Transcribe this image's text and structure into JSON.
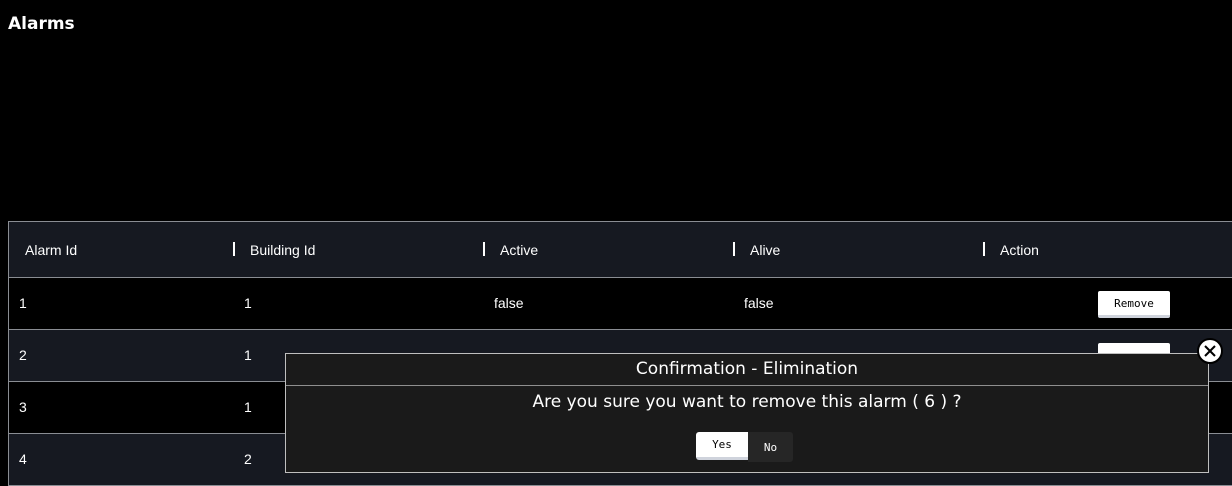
{
  "page": {
    "title": "Alarms"
  },
  "table": {
    "headers": [
      "Alarm Id",
      "Building Id",
      "Active",
      "Alive",
      "Action"
    ],
    "rows": [
      {
        "alarm_id": "1",
        "building_id": "1",
        "active": "false",
        "alive": "false",
        "action_label": "Remove"
      },
      {
        "alarm_id": "2",
        "building_id": "1",
        "active": "",
        "alive": "",
        "action_label": ""
      },
      {
        "alarm_id": "3",
        "building_id": "1",
        "active": "",
        "alive": "",
        "action_label": ""
      },
      {
        "alarm_id": "4",
        "building_id": "2",
        "active": "",
        "alive": "",
        "action_label": ""
      }
    ]
  },
  "dialog": {
    "title": "Confirmation - Elimination",
    "message": "Are you sure you want to remove this alarm ( 6 ) ?",
    "yes_label": "Yes",
    "no_label": "No",
    "close_icon": "close-icon"
  },
  "colors": {
    "background": "#000000",
    "header_background": "#161921",
    "even_row_background": "#161921",
    "dialog_background": "#1a1a1a",
    "button_background": "#ffffff"
  }
}
